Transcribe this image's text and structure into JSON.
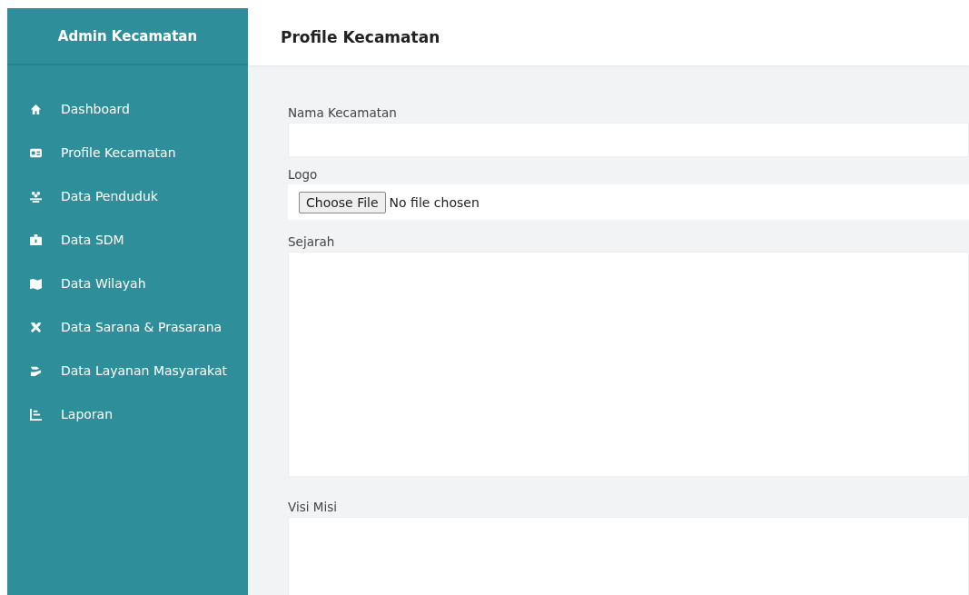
{
  "sidebar": {
    "brand": "Admin Kecamatan",
    "items": [
      {
        "label": "Dashboard"
      },
      {
        "label": "Profile Kecamatan"
      },
      {
        "label": "Data Penduduk"
      },
      {
        "label": "Data SDM"
      },
      {
        "label": "Data Wilayah"
      },
      {
        "label": "Data Sarana & Prasarana"
      },
      {
        "label": "Data Layanan Masyarakat"
      },
      {
        "label": "Laporan"
      }
    ]
  },
  "header": {
    "title": "Profile Kecamatan"
  },
  "form": {
    "fields": [
      {
        "kind": "text",
        "label": "Nama Kecamatan"
      },
      {
        "kind": "file",
        "label": "Logo",
        "button": "Choose File",
        "status": "No file chosen"
      },
      {
        "kind": "textarea",
        "label": "Sejarah"
      },
      {
        "kind": "textarea",
        "label": "Visi Misi"
      }
    ]
  }
}
